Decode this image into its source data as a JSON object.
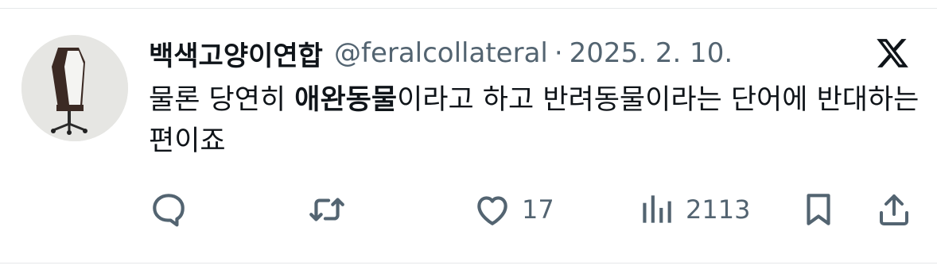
{
  "post": {
    "author_name": "백색고양이연합",
    "handle": "@feralcollateral",
    "separator": "·",
    "date": "2025. 2. 10.",
    "text_parts": {
      "part1": "물론 당연히 ",
      "bold": "애완동물",
      "part2": "이라고 하고 반려동물이라는 단어에 반대하는편이죠"
    }
  },
  "actions": {
    "like_count": "17",
    "views_count": "2113"
  },
  "icons": {
    "brand": "x-logo-icon",
    "reply": "reply-icon",
    "repost": "repost-icon",
    "like": "heart-icon",
    "views": "views-icon",
    "bookmark": "bookmark-icon",
    "share": "share-icon"
  },
  "colors": {
    "text_primary": "#0f1419",
    "text_secondary": "#536471",
    "divider": "#e6e8ea"
  }
}
